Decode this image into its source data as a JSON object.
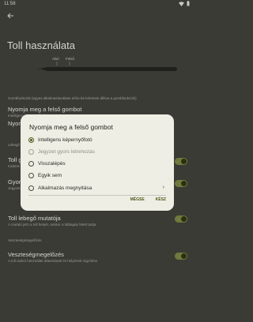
{
  "status_bar": {
    "time": "11:58"
  },
  "page": {
    "title": "Toll használata"
  },
  "pen": {
    "label_left": "Alsó",
    "label_right": "Felső"
  },
  "sections": {
    "gombfunkciok": "Gombfunkciók (egyes alkalmazásokban előre be lehetnek állítva a gombfunkciók)",
    "lebego": "Lebegő",
    "vesztesegmegelozes": "Veszteségmegelőzés"
  },
  "settings": {
    "nyomja_felso": {
      "title": "Nyomja meg a felső gombot",
      "sub": "Intelligens képernyőfotó"
    },
    "nyomja_2": {
      "title": "Nyoma"
    },
    "toll_g": {
      "title": "Toll g",
      "sub": "Kattints"
    },
    "gyors": {
      "title": "Gyors",
      "sub": "Jegyzet"
    },
    "lebego_mutato": {
      "title": "Toll lebegő mutatója",
      "sub": "A mutató jelzi a toll helyét, amikor a táblagép felett tartja"
    },
    "veszteseg": {
      "title": "Veszteségmegelőzés",
      "sub": "A toll utolsó használati dátumának és helyének rögzítése"
    }
  },
  "dialog": {
    "title": "Nyomja meg a felső gombot",
    "options": [
      {
        "label": "Intelligens képernyőfotó",
        "selected": true,
        "enabled": true
      },
      {
        "label": "Jegyzet gyors létrehozás",
        "selected": false,
        "enabled": false
      },
      {
        "label": "Visszalépés",
        "selected": false,
        "enabled": true
      },
      {
        "label": "Egyik sem",
        "selected": false,
        "enabled": true
      },
      {
        "label": "Alkalmazás megnyitása",
        "selected": false,
        "enabled": true
      }
    ],
    "cancel": "MÉGSE",
    "done": "KÉSZ"
  },
  "colors": {
    "accent": "#4f5a1e",
    "toggle_on": "#6e7a3e",
    "background": "#3a3b35",
    "dialog": "#eeeee4"
  }
}
